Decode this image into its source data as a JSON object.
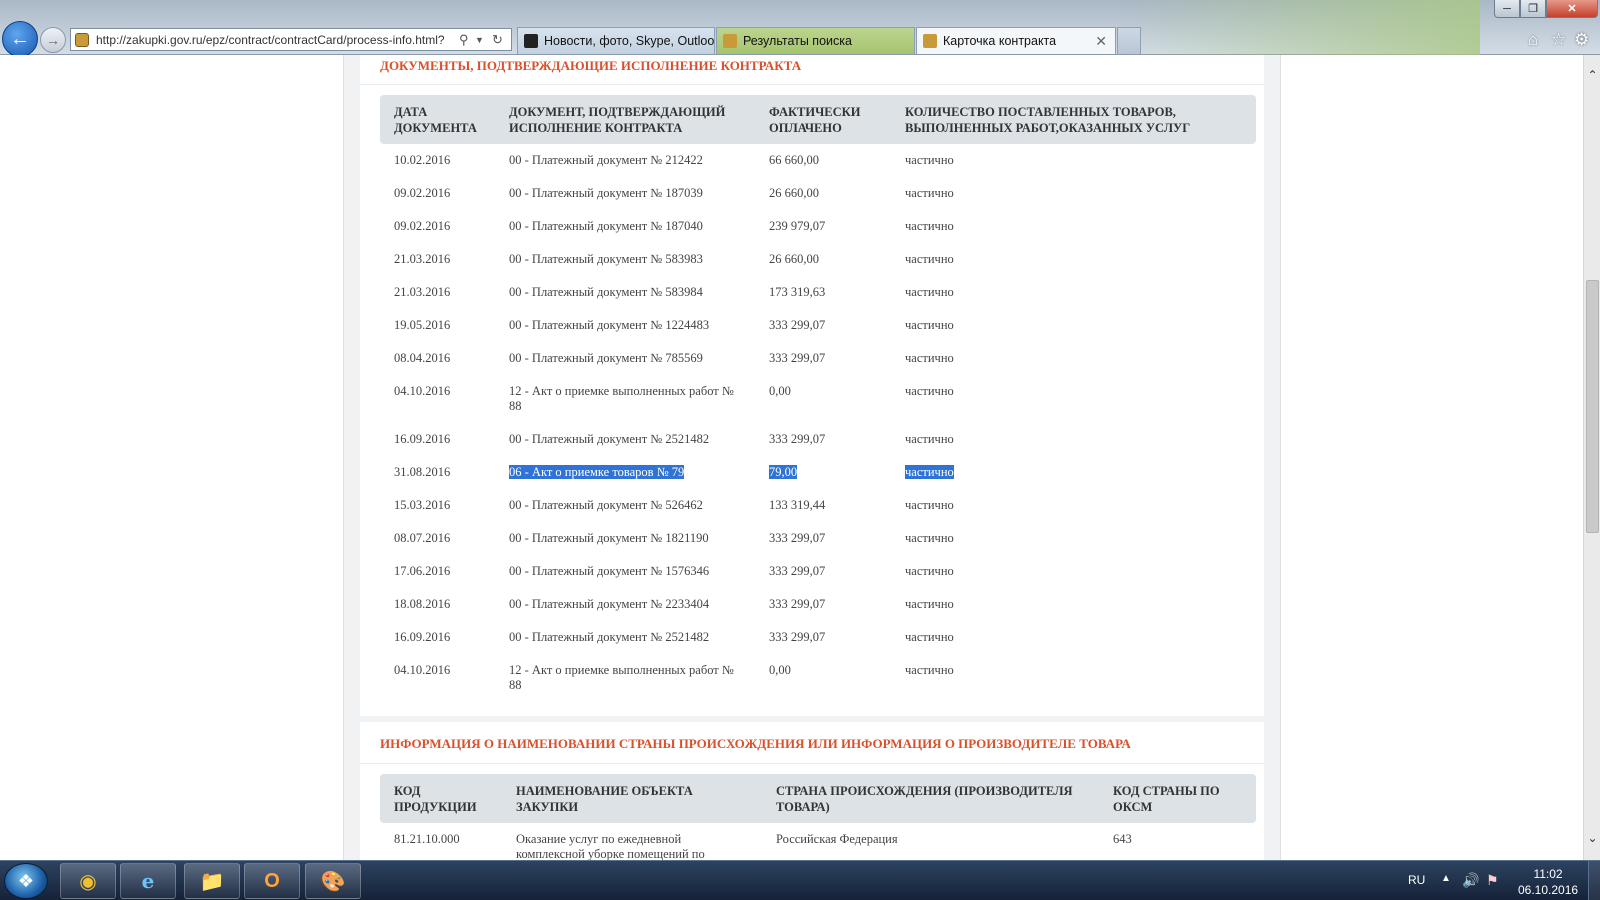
{
  "browser": {
    "url": "http://zakupki.gov.ru/epz/contract/contractCard/process-info.html?",
    "tabs": [
      {
        "title": "Новости, фото, Skype, Outloo..."
      },
      {
        "title": "Результаты поиска"
      },
      {
        "title": "Карточка контракта"
      }
    ]
  },
  "section1": {
    "title": "ДОКУМЕНТЫ, ПОДТВЕРЖДАЮЩИЕ ИСПОЛНЕНИЕ КОНТРАКТА",
    "headers": {
      "date": "ДАТА ДОКУМЕНТА",
      "doc": "ДОКУМЕНТ, ПОДТВЕРЖДАЮЩИЙ ИСПОЛНЕНИЕ КОНТРАКТА",
      "paid": "ФАКТИЧЕСКИ ОПЛАЧЕНО",
      "qty": "КОЛИЧЕСТВО ПОСТАВЛЕННЫХ ТОВАРОВ, ВЫПОЛНЕННЫХ РАБОТ,ОКАЗАННЫХ УСЛУГ"
    },
    "rows": [
      {
        "date": "10.02.2016",
        "doc": "00 - Платежный документ № 212422",
        "paid": "66 660,00",
        "qty": "частично"
      },
      {
        "date": "09.02.2016",
        "doc": "00 - Платежный документ № 187039",
        "paid": "26 660,00",
        "qty": "частично"
      },
      {
        "date": "09.02.2016",
        "doc": "00 - Платежный документ № 187040",
        "paid": "239 979,07",
        "qty": "частично"
      },
      {
        "date": "21.03.2016",
        "doc": "00 - Платежный документ № 583983",
        "paid": "26 660,00",
        "qty": "частично"
      },
      {
        "date": "21.03.2016",
        "doc": "00 - Платежный документ № 583984",
        "paid": "173 319,63",
        "qty": "частично"
      },
      {
        "date": "19.05.2016",
        "doc": "00 - Платежный документ № 1224483",
        "paid": "333 299,07",
        "qty": "частично"
      },
      {
        "date": "08.04.2016",
        "doc": "00 - Платежный документ № 785569",
        "paid": "333 299,07",
        "qty": "частично"
      },
      {
        "date": "04.10.2016",
        "doc": "12 - Акт о приемке выполненных работ № 88",
        "paid": "0,00",
        "qty": "частично"
      },
      {
        "date": "16.09.2016",
        "doc": "00 - Платежный документ № 2521482",
        "paid": "333 299,07",
        "qty": "частично"
      },
      {
        "date": "31.08.2016",
        "doc": "06 - Акт о приемке товаров № 79",
        "paid": "79,00",
        "qty": "частично"
      },
      {
        "date": "15.03.2016",
        "doc": "00 - Платежный документ № 526462",
        "paid": "133 319,44",
        "qty": "частично"
      },
      {
        "date": "08.07.2016",
        "doc": "00 - Платежный документ № 1821190",
        "paid": "333 299,07",
        "qty": "частично"
      },
      {
        "date": "17.06.2016",
        "doc": "00 - Платежный документ № 1576346",
        "paid": "333 299,07",
        "qty": "частично"
      },
      {
        "date": "18.08.2016",
        "doc": "00 - Платежный документ № 2233404",
        "paid": "333 299,07",
        "qty": "частично"
      },
      {
        "date": "16.09.2016",
        "doc": "00 - Платежный документ № 2521482",
        "paid": "333 299,07",
        "qty": "частично"
      },
      {
        "date": "04.10.2016",
        "doc": "12 - Акт о приемке выполненных работ № 88",
        "paid": "0,00",
        "qty": "частично"
      }
    ]
  },
  "section2": {
    "title": "ИНФОРМАЦИЯ О НАИМЕНОВАНИИ СТРАНЫ ПРОИСХОЖДЕНИЯ ИЛИ ИНФОРМАЦИЯ О ПРОИЗВОДИТЕЛЕ ТОВАРА",
    "headers": {
      "code": "КОД ПРОДУКЦИИ",
      "name": "НАИМЕНОВАНИЕ ОБЪЕКТА ЗАКУПКИ",
      "country": "СТРАНА ПРОИСХОЖДЕНИЯ (ПРОИЗВОДИТЕЛЯ ТОВАРА)",
      "oksm": "КОД СТРАНЫ ПО ОКСМ"
    },
    "rows": [
      {
        "code": "81.21.10.000",
        "name": "Оказание услуг по ежедневной комплексной уборке помещений по",
        "country": "Российская Федерация",
        "oksm": "643"
      }
    ]
  },
  "taskbar": {
    "lang": "RU",
    "time": "11:02",
    "date": "06.10.2016"
  },
  "selected_row_index": 9
}
